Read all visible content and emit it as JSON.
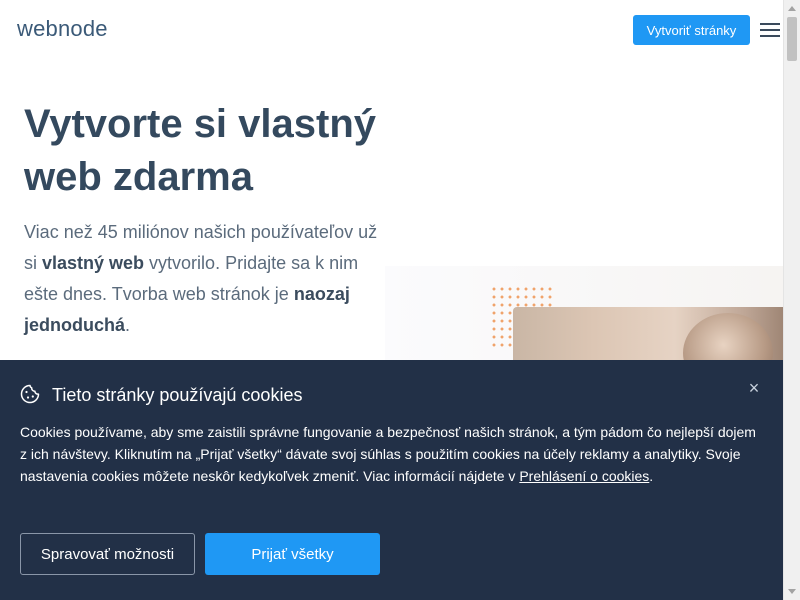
{
  "header": {
    "logo_text": "webnode",
    "cta_label": "Vytvoriť stránky",
    "menu_icon": "hamburger-menu-icon"
  },
  "hero": {
    "title": "Vytvorte si vlastný web zdarma",
    "text_part1": "Viac než 45 miliónov našich používateľov už si ",
    "text_bold1": "vlastný web",
    "text_part2": " vytvorilo. Pridajte sa k nim ešte dnes. Tvorba web stránok je ",
    "text_bold2": "naozaj jednoduchá",
    "text_part3": "."
  },
  "cookie_banner": {
    "icon": "cookie-icon",
    "title": "Tieto stránky používajú cookies",
    "text": "Cookies používame, aby sme zaistili správne fungovanie a bezpečnosť našich stránok, a tým pádom čo nejlepší dojem z ich návštevy. Kliknutím na „Prijať všetky“ dávate svoj súhlas s použitím cookies na účely reklamy a analytiky. Svoje nastavenia cookies môžete neskôr kedykoľvek zmeniť. Viac informácií nájdete v ",
    "link_text": "Prehlásení o cookies",
    "text_end": ".",
    "manage_label": "Spravovať možnosti",
    "accept_label": "Prijať všetky",
    "close_symbol": "×"
  },
  "colors": {
    "brand_blue": "#1f98f4",
    "heading": "#34495e",
    "banner_bg": "#223047"
  }
}
